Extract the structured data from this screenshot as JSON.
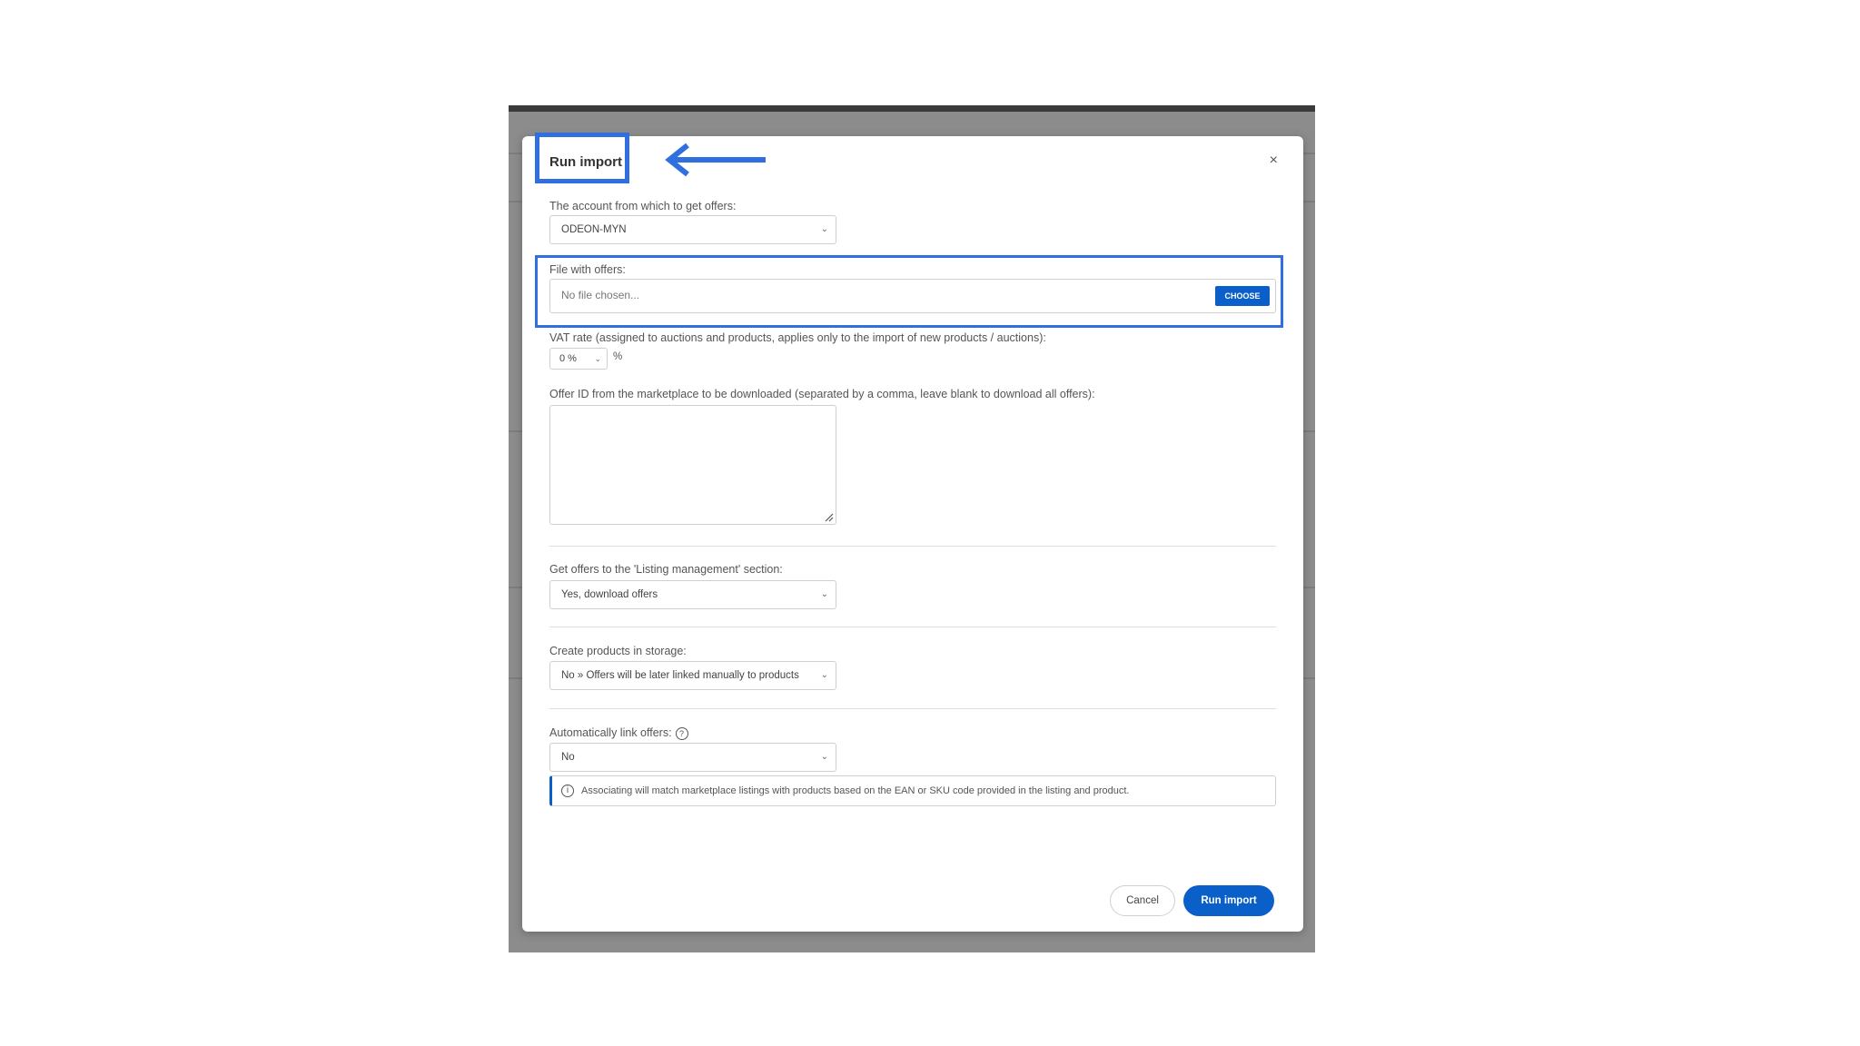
{
  "modal": {
    "title": "Run import",
    "close_glyph": "×"
  },
  "account": {
    "label": "The account from which to get offers:",
    "value": "ODEON-MYN"
  },
  "file": {
    "label": "File with offers:",
    "placeholder": "No file chosen...",
    "choose_label": "CHOOSE"
  },
  "vat": {
    "label": "VAT rate (assigned to auctions and products, applies only to the import of new products / auctions):",
    "value": "0 %",
    "unit": "%"
  },
  "offer_ids": {
    "label": "Offer ID from the marketplace to be downloaded (separated by a comma, leave blank to download all offers):",
    "value": ""
  },
  "listing": {
    "label": "Get offers to the 'Listing management' section:",
    "value": "Yes, download offers"
  },
  "storage": {
    "label": "Create products in storage:",
    "value": "No » Offers will be later linked manually to products"
  },
  "autolink": {
    "label": "Automatically link offers:",
    "value": "No",
    "help_glyph": "?",
    "info_glyph": "i",
    "info_text": "Associating will match marketplace listings with products based on the EAN or SKU code provided in the listing and product."
  },
  "footer": {
    "cancel_label": "Cancel",
    "run_label": "Run import"
  },
  "colors": {
    "accent": "#0b5fc9",
    "highlight": "#2f6fe0",
    "backdrop": "#8c8c8c"
  },
  "chevron_glyph": "⌄"
}
